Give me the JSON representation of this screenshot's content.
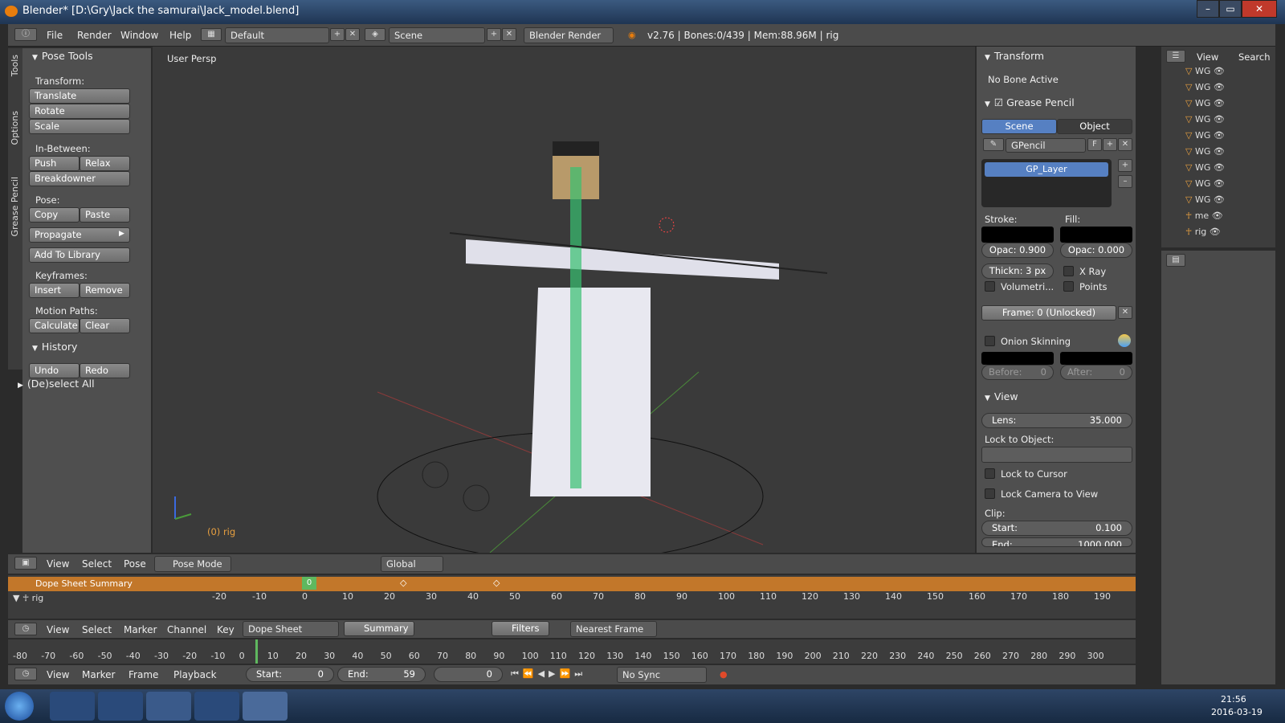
{
  "window": {
    "title": "Blender* [D:\\Gry\\Jack the samurai\\Jack_model.blend]",
    "minimize": "▭",
    "maximize": "▭",
    "close": "✕"
  },
  "menubar": {
    "items": [
      "File",
      "Render",
      "Window",
      "Help"
    ],
    "layout": "Default",
    "scene": "Scene",
    "engine": "Blender Render",
    "stats": "v2.76 | Bones:0/439 | Mem:88.96M | rig"
  },
  "toolshelf": {
    "tabs": [
      "Tools",
      "Options",
      "Grease Pencil"
    ],
    "title": "Pose Tools",
    "transform_label": "Transform:",
    "translate": "Translate",
    "rotate": "Rotate",
    "scale": "Scale",
    "inbetween_label": "In-Between:",
    "push": "Push",
    "relax": "Relax",
    "breakdowner": "Breakdowner",
    "pose_label": "Pose:",
    "copy": "Copy",
    "paste": "Paste",
    "propagate": "Propagate",
    "add_library": "Add To Library",
    "keyframes_label": "Keyframes:",
    "insert": "Insert",
    "remove": "Remove",
    "motion_label": "Motion Paths:",
    "calculate": "Calculate",
    "clear": "Clear",
    "history": "History",
    "undo": "Undo",
    "redo": "Redo",
    "deselect": "(De)select All"
  },
  "viewport": {
    "label": "User Persp",
    "frame_info": "(0) rig"
  },
  "properties": {
    "transform": "Transform",
    "no_bone": "No Bone Active",
    "grease_pencil": "Grease Pencil",
    "scene_tab": "Scene",
    "object_tab": "Object",
    "gpencil": "GPencil",
    "f": "F",
    "layer": "GP_Layer",
    "stroke": "Stroke:",
    "fill": "Fill:",
    "stroke_opac": "Opac: 0.900",
    "fill_opac": "Opac: 0.000",
    "thickness": "Thickn: 3 px",
    "xray": "X Ray",
    "volumetric": "Volumetri...",
    "points": "Points",
    "frame": "Frame: 0 (Unlocked)",
    "onion": "Onion Skinning",
    "before": "Before:",
    "before_val": "0",
    "after": "After:",
    "after_val": "0",
    "view": "View",
    "lens_label": "Lens:",
    "lens_val": "35.000",
    "lock_object": "Lock to Object:",
    "lock_cursor": "Lock to Cursor",
    "lock_camera": "Lock Camera to View",
    "clip": "Clip:",
    "clip_start": "Start:",
    "clip_start_val": "0.100",
    "clip_end": "End:",
    "clip_end_val": "1000.000"
  },
  "outliner": {
    "view": "View",
    "search": "Search",
    "rows": [
      "WG",
      "WG",
      "WG",
      "WG",
      "WG",
      "WG",
      "WG",
      "WG",
      "WG",
      "me",
      "rig"
    ]
  },
  "view3d_header": {
    "items": [
      "View",
      "Select",
      "Pose"
    ],
    "mode": "Pose Mode",
    "orientation": "Global"
  },
  "dopesheet": {
    "channels": [
      "Dope Sheet Summary",
      "rig"
    ],
    "current_frame": "0",
    "ruler": [
      "-20",
      "-10",
      "0",
      "10",
      "20",
      "30",
      "40",
      "50",
      "60",
      "70",
      "80",
      "90",
      "100",
      "110",
      "120",
      "130",
      "140",
      "150",
      "160",
      "170",
      "180",
      "190"
    ],
    "header": [
      "View",
      "Select",
      "Marker",
      "Channel",
      "Key"
    ],
    "mode": "Dope Sheet",
    "summary": "Summary",
    "filters": "Filters",
    "snap": "Nearest Frame"
  },
  "timeline": {
    "ruler": [
      "-80",
      "-70",
      "-60",
      "-50",
      "-40",
      "-30",
      "-20",
      "-10",
      "0",
      "10",
      "20",
      "30",
      "40",
      "50",
      "60",
      "70",
      "80",
      "90",
      "100",
      "110",
      "120",
      "130",
      "140",
      "150",
      "160",
      "170",
      "180",
      "190",
      "200",
      "210",
      "220",
      "230",
      "240",
      "250",
      "260",
      "270",
      "280",
      "290",
      "300"
    ],
    "header": [
      "View",
      "Marker",
      "Frame",
      "Playback"
    ],
    "start_label": "Start:",
    "start": "0",
    "end_label": "End:",
    "end": "59",
    "current": "0",
    "sync": "No Sync"
  },
  "taskbar": {
    "time": "21:56",
    "date": "2016-03-19"
  }
}
